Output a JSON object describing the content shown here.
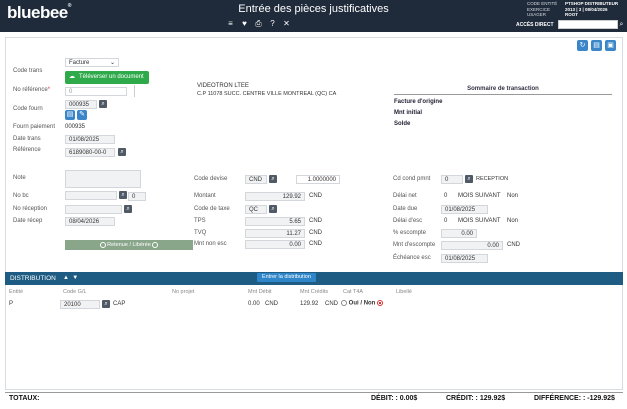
{
  "header": {
    "logo": "bluebee",
    "logo_mark": "®",
    "title": "Entrée des pièces justificatives",
    "context_labels": [
      "CODE ENTITÉ",
      "EXERCICE",
      "USAGER"
    ],
    "context_values": [
      "PTSHOP DISTRIBUTEUR",
      "2013 | 3 | 08/04/2026",
      "ROOT"
    ],
    "access_label": "ACCÈS DIRECT"
  },
  "form": {
    "code_trans_label": "Code trans",
    "code_trans_value": "Facture",
    "upload_label": "Téléverser un document",
    "no_reference_label": "No référence",
    "no_reference_value": "0",
    "code_fourn_label": "Code fourn",
    "code_fourn_value": "000935",
    "fourn_paiement_label": "Fourn paiement",
    "fourn_paiement_value": "000935",
    "date_trans_label": "Date trans",
    "date_trans_value": "01/08/2025",
    "reference_label": "Référence",
    "reference_value": "6189080-00-0",
    "vendor_name": "VIDEOTRON LTEE",
    "vendor_address": "C.P 11078 SUCC. CENTRE VILLE  MONTREAL  (QC)  CA",
    "note_label": "Note",
    "no_bc_label": "No bc",
    "no_bc_value": "0",
    "no_reception_label": "No réception",
    "date_recep_label": "Date récep",
    "date_recep_value": "08/04/2026",
    "retenue_label": "Retenue / Libérée",
    "code_devise_label": "Code devise",
    "code_devise_value": "CND",
    "rate_value": "1.0000000",
    "montant_label": "Montant",
    "montant_value": "129.92",
    "montant_cur": "CND",
    "code_taxe_label": "Code de taxe",
    "code_taxe_value": "QC",
    "tps_label": "TPS",
    "tps_value": "5.65",
    "tps_cur": "CND",
    "tvq_label": "TVQ",
    "tvq_value": "11.27",
    "tvq_cur": "CND",
    "mnt_non_esc_label": "Mnt non esc",
    "mnt_non_esc_value": "0.00",
    "mnt_non_esc_cur": "CND",
    "cd_cond_pmt_label": "Cd cond pmnt",
    "cd_cond_pmt_value": "0",
    "cd_cond_pmt_desc": "RECEPTION",
    "delai_net_label": "Délai net",
    "delai_net_value": "0",
    "delai_net_desc": "MOIS SUIVANT",
    "delai_net_flag": "Non",
    "date_due_label": "Date due",
    "date_due_value": "01/08/2025",
    "delai_esc_label": "Délai d'esc",
    "delai_esc_value": "0",
    "delai_esc_desc": "MOIS SUIVANT",
    "delai_esc_flag": "Non",
    "pct_escompte_label": "% escompte",
    "pct_escompte_value": "0.00",
    "mnt_escompte_label": "Mnt d'escompte",
    "mnt_escompte_value": "0.00",
    "mnt_escompte_cur": "CND",
    "echeance_esc_label": "Échéance esc",
    "echeance_esc_value": "01/08/2025"
  },
  "summary": {
    "title": "Sommaire de transaction",
    "facture_origine": "Facture d'origine",
    "mnt_initial": "Mnt initial",
    "solde": "Solde"
  },
  "distribution": {
    "title": "DISTRIBUTION",
    "enter_button": "Entrer la distribution",
    "columns": [
      "Entité",
      "Code G/L",
      "No projet",
      "Mnt Débit",
      "Mnt Crédits",
      "Cat T4A",
      "Libellé"
    ],
    "row": {
      "entite": "P",
      "code_gl": "20100",
      "code_gl_desc": "CAP",
      "mnt_debit": "0.00",
      "mnt_debit_cur": "CND",
      "mnt_credit": "129.92",
      "mnt_credit_cur": "CND",
      "oui": "Oui",
      "non": "Non"
    }
  },
  "totals": {
    "label": "TOTAUX:",
    "debit": "DÉBIT: : 0.00$",
    "credit": "CRÉDIT: : 129.92$",
    "difference": "DIFFÉRENCE: : -129.92$"
  },
  "icons": {
    "menu": "menu-icon",
    "favorite": "heart-icon",
    "print": "print-icon",
    "help": "help-icon",
    "close": "close-icon",
    "refresh": "refresh-icon",
    "delete": "trash-icon",
    "save": "save-icon"
  }
}
